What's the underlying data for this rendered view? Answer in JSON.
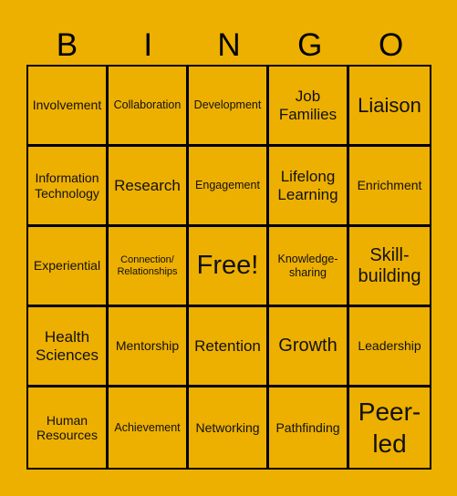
{
  "title_letters": [
    "B",
    "I",
    "N",
    "G",
    "O"
  ],
  "colors": {
    "background": "#edb000",
    "grid_lines": "#000000",
    "text": "#111111"
  },
  "cells": [
    [
      "Involvement",
      "Collaboration",
      "Development",
      "Job Families",
      "Liaison"
    ],
    [
      "Information Technology",
      "Research",
      "Engagement",
      "Lifelong Learning",
      "Enrichment"
    ],
    [
      "Experiential",
      "Connection/ Relationships",
      "Free!",
      "Knowledge-sharing",
      "Skill-building"
    ],
    [
      "Health Sciences",
      "Mentorship",
      "Retention",
      "Growth",
      "Leadership"
    ],
    [
      "Human Resources",
      "Achievement",
      "Networking",
      "Pathfinding",
      "Peer-led"
    ]
  ]
}
